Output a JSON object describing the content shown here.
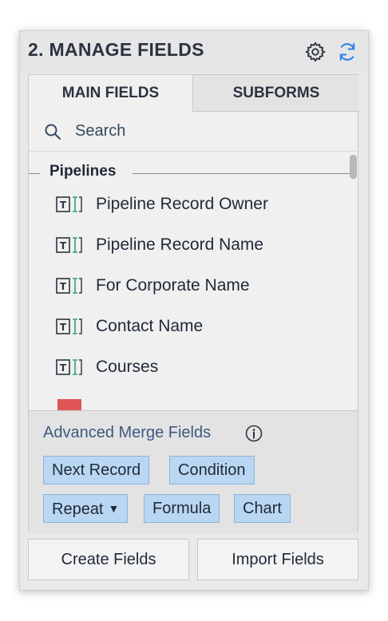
{
  "header": {
    "title": "2. MANAGE FIELDS",
    "settings_icon": "gear-icon",
    "refresh_icon": "refresh-icon"
  },
  "tabs": [
    {
      "label": "MAIN FIELDS",
      "active": true
    },
    {
      "label": "SUBFORMS",
      "active": false
    }
  ],
  "search": {
    "placeholder": "Search",
    "icon": "search-icon"
  },
  "field_groups": [
    {
      "label": "Pipelines",
      "items": [
        {
          "label": "Pipeline Record Owner",
          "icon": "text-field-icon"
        },
        {
          "label": "Pipeline Record Name",
          "icon": "text-field-icon"
        },
        {
          "label": "For Corporate Name",
          "icon": "text-field-icon"
        },
        {
          "label": "Contact Name",
          "icon": "text-field-icon"
        },
        {
          "label": "Courses",
          "icon": "text-field-icon"
        }
      ]
    }
  ],
  "advanced_merge": {
    "title": "Advanced Merge Fields",
    "info_icon": "info-icon",
    "buttons": [
      {
        "label": "Next Record"
      },
      {
        "label": "Condition"
      },
      {
        "label": "Repeat",
        "dropdown": true
      },
      {
        "label": "Formula"
      },
      {
        "label": "Chart"
      }
    ]
  },
  "actions": {
    "create_label": "Create Fields",
    "import_label": "Import Fields"
  },
  "colors": {
    "accent_blue": "#b9d6f2",
    "title_text": "#2b3440",
    "advanced_title": "#3d5a80",
    "icon_blue": "#2f80ed"
  }
}
